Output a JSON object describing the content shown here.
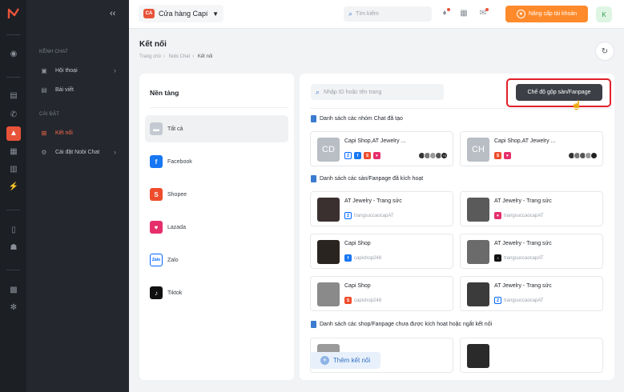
{
  "app": {
    "store_initials": "CA",
    "store_name": "Cửa hàng Capi",
    "avatar_letter": "K"
  },
  "topbar": {
    "search_placeholder": "Tìm kiếm",
    "upgrade_label": "Nâng cấp tài khoản"
  },
  "subnav": {
    "section_chat": "KÊNH CHAT",
    "item_conversations": "Hội thoại",
    "item_posts": "Bài viết",
    "section_settings": "CÀI ĐẶT",
    "item_connect": "Kết nối",
    "item_nobi_settings": "Cài đặt Nobi Chat"
  },
  "page": {
    "title": "Kết nối",
    "breadcrumb": [
      "Trang chủ",
      "Nobi Chat",
      "Kết nối"
    ]
  },
  "platforms": {
    "title": "Nền tảng",
    "items": [
      {
        "label": "Tất cả",
        "color": "#c5cad2"
      },
      {
        "label": "Facebook",
        "color": "#1877f2"
      },
      {
        "label": "Shopee",
        "color": "#ee4d2d"
      },
      {
        "label": "Lazada",
        "color": "#e62e6b"
      },
      {
        "label": "Zalo",
        "color": "#0068ff"
      },
      {
        "label": "Tiktok",
        "color": "#111111"
      }
    ]
  },
  "connections": {
    "search_placeholder": "Nhập ID hoặc tên trang",
    "mode_button": "Chế độ gộp sàn/Fanpage",
    "group_section": "Danh sách các nhóm Chat đã tạo",
    "groups": [
      {
        "initials": "CD",
        "name": "Capi Shop,AT Jewelry ...",
        "extra": "+3"
      },
      {
        "initials": "CH",
        "name": "Capi Shop,AT Jewelry ..."
      }
    ],
    "active_section": "Danh sách các sàn/Fanpage đã kích hoạt",
    "active": [
      {
        "name": "AT Jewelry - Trang sức",
        "handle": "trangsuccaocapAT",
        "channel": "zalo",
        "thumb": "#3a3030"
      },
      {
        "name": "AT Jewelry - Trang sức",
        "handle": "trangsuccaocapAT",
        "channel": "lazada",
        "thumb": "#5a5a5a"
      },
      {
        "name": "Capi Shop",
        "handle": "capishop248",
        "channel": "facebook",
        "thumb": "#2a2420"
      },
      {
        "name": "AT Jewelry - Trang sức",
        "handle": "trangsuccaocapAT",
        "channel": "tiktok",
        "thumb": "#6b6b6b"
      },
      {
        "name": "Capi Shop",
        "handle": "capishop248",
        "channel": "shopee",
        "thumb": "#8a8a8a"
      },
      {
        "name": "AT Jewelry - Trang sức",
        "handle": "trangsuccaocapAT",
        "channel": "zalo",
        "thumb": "#3b3b3b"
      }
    ],
    "inactive_section": "Danh sách các shop/Fanpage chưa được kích hoạt hoặc ngắt kết nối",
    "add_button": "Thêm kết nối"
  },
  "colors": {
    "accent": "#e8543a",
    "upgrade": "#ff8a2b",
    "primary_blue": "#3b7cd1",
    "highlight_ring": "#e0202a"
  }
}
